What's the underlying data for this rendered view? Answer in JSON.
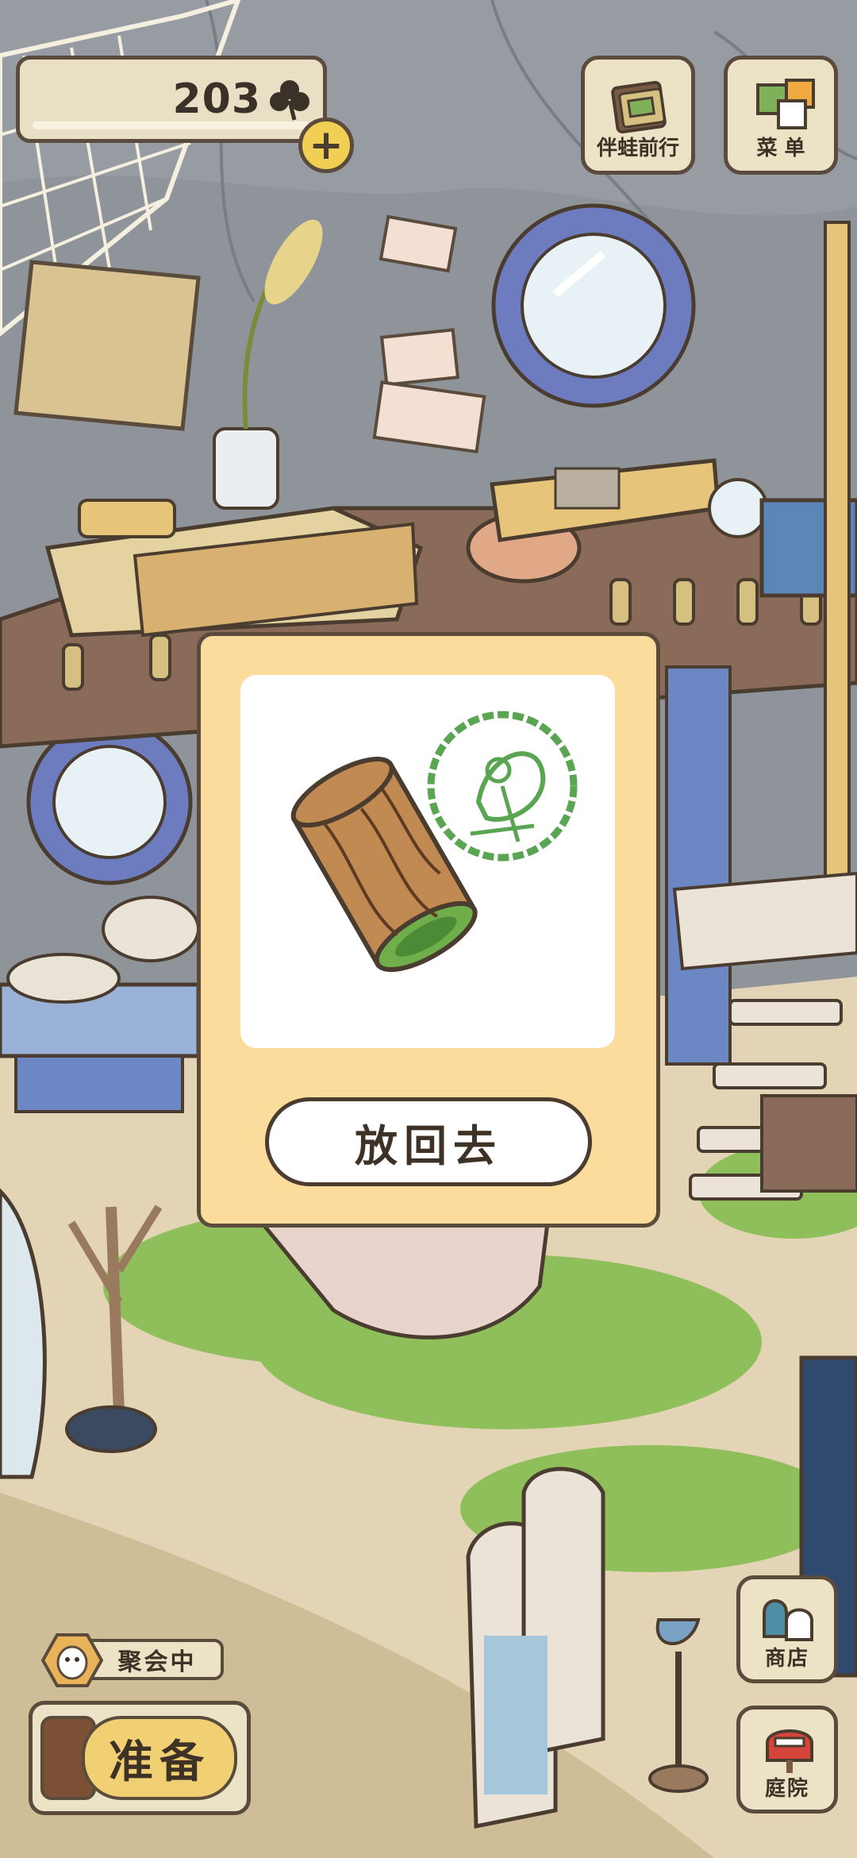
{
  "hud": {
    "clover_count": "203",
    "clover_icon": "clover-icon",
    "add_icon": "plus-icon",
    "add_label": "+"
  },
  "top_menu": {
    "travel_label": "伴蛙前行",
    "menu_label": "菜 单"
  },
  "item_card": {
    "item_icon": "wood-log-icon",
    "stamp_icon": "frog-stamp-icon",
    "button_label": "放回去"
  },
  "bottom": {
    "party_status": "聚会中",
    "prepare_label": "准备",
    "shop_label": "商店",
    "garden_label": "庭院"
  },
  "colors": {
    "card_bg": "#fbdc9d",
    "outline": "#5a4b3c",
    "stamp_green": "#5aa552",
    "floor": "#e2d4b4",
    "grass": "#8fbf5a"
  }
}
